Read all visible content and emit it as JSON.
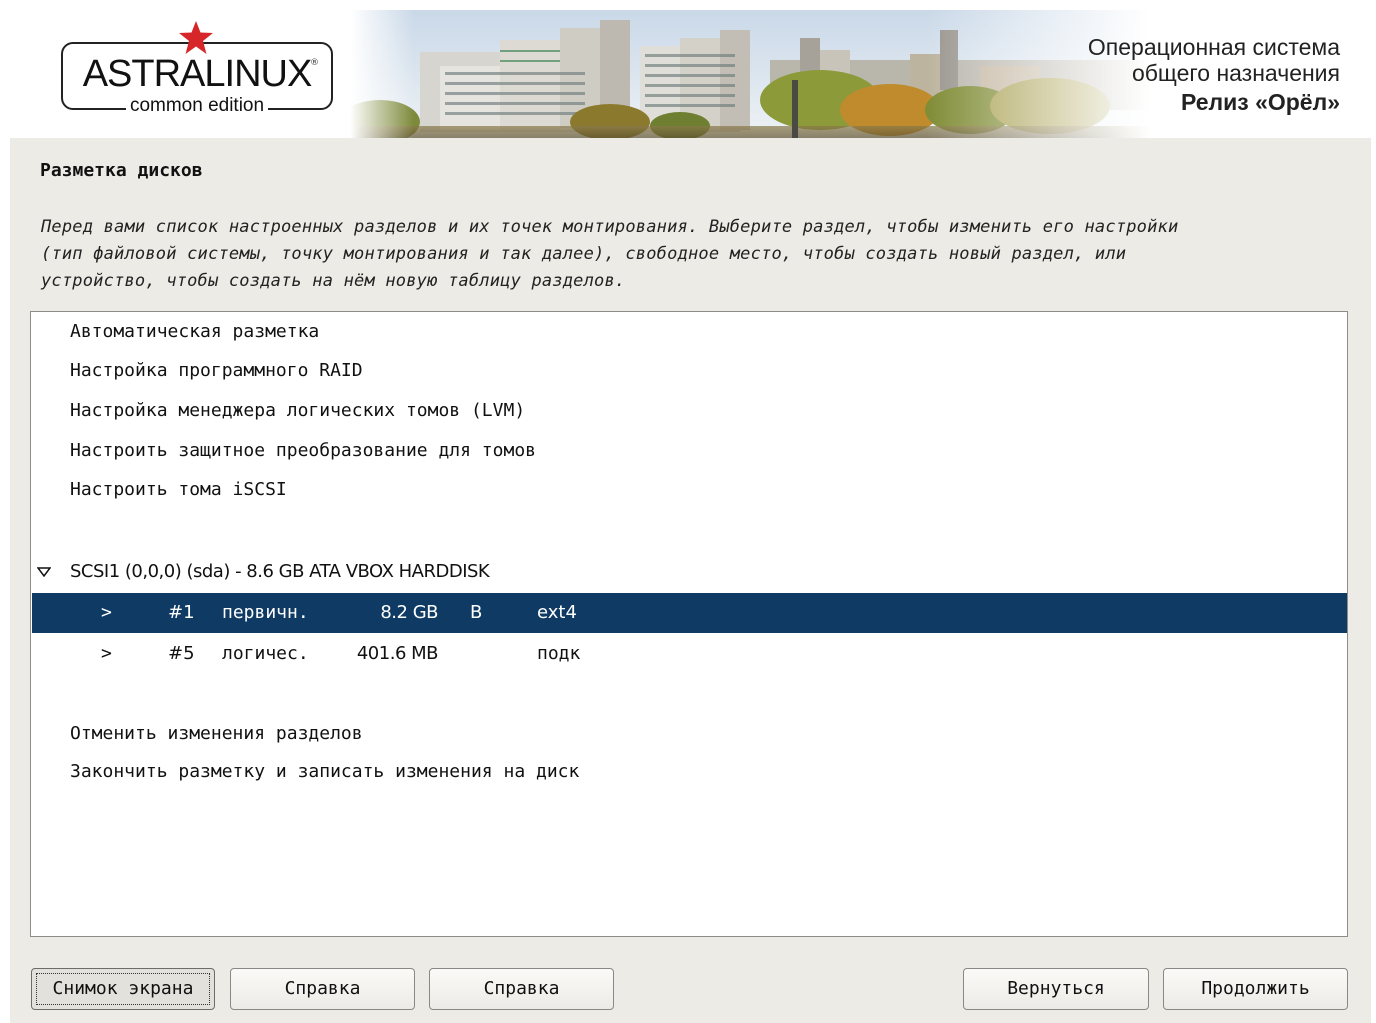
{
  "header": {
    "logo_name": "ASTRALINUX",
    "logo_registered": "®",
    "logo_edition": "common edition",
    "os_line1": "Операционная система",
    "os_line2": "общего назначения",
    "os_release": "Релиз «Орёл»"
  },
  "page": {
    "title": "Разметка дисков",
    "description_lines": [
      "Перед вами список настроенных разделов и их точек монтирования. Выберите раздел, чтобы изменить его настройки",
      "(тип файловой системы, точку монтирования и так далее), свободное место, чтобы создать новый раздел, или",
      "устройство, чтобы создать на нём новую таблицу разделов."
    ]
  },
  "list": {
    "menu_items": [
      "Автоматическая разметка",
      "Настройка программного RAID",
      "Настройка менеджера логических томов (LVM)",
      "Настроить защитное преобразование для томов",
      "Настроить тома iSCSI"
    ],
    "disk": {
      "label": "SCSI1 (0,0,0) (sda) - 8.6 GB ATA VBOX HARDDISK",
      "icon": "triangle-down-icon"
    },
    "partitions": [
      {
        "arrow": ">",
        "number": "#1",
        "type": "первичн.",
        "size": "8.2 GB",
        "flag": "B",
        "fs": "ext4",
        "selected": true
      },
      {
        "arrow": ">",
        "number": "#5",
        "type": "логичес.",
        "size": "401.6 MB",
        "flag": "",
        "fs": "подк",
        "selected": false
      }
    ],
    "footer_items": [
      "Отменить изменения разделов",
      "Закончить разметку и записать изменения на диск"
    ]
  },
  "buttons": {
    "screenshot": "Снимок экрана",
    "help1": "Справка",
    "help2": "Справка",
    "back": "Вернуться",
    "continue": "Продолжить"
  },
  "colors": {
    "selection": "#0e3a63",
    "panel_bg": "#edebe6",
    "logo_star": "#d6262a"
  }
}
